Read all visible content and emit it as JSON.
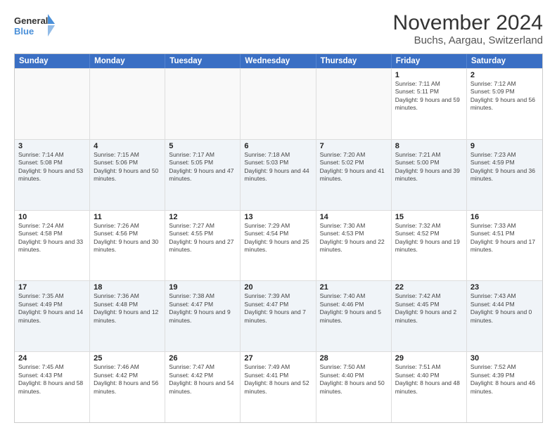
{
  "logo": {
    "line1": "General",
    "line2": "Blue"
  },
  "title": "November 2024",
  "subtitle": "Buchs, Aargau, Switzerland",
  "days": [
    "Sunday",
    "Monday",
    "Tuesday",
    "Wednesday",
    "Thursday",
    "Friday",
    "Saturday"
  ],
  "rows": [
    [
      {
        "day": "",
        "info": ""
      },
      {
        "day": "",
        "info": ""
      },
      {
        "day": "",
        "info": ""
      },
      {
        "day": "",
        "info": ""
      },
      {
        "day": "",
        "info": ""
      },
      {
        "day": "1",
        "info": "Sunrise: 7:11 AM\nSunset: 5:11 PM\nDaylight: 9 hours and 59 minutes."
      },
      {
        "day": "2",
        "info": "Sunrise: 7:12 AM\nSunset: 5:09 PM\nDaylight: 9 hours and 56 minutes."
      }
    ],
    [
      {
        "day": "3",
        "info": "Sunrise: 7:14 AM\nSunset: 5:08 PM\nDaylight: 9 hours and 53 minutes."
      },
      {
        "day": "4",
        "info": "Sunrise: 7:15 AM\nSunset: 5:06 PM\nDaylight: 9 hours and 50 minutes."
      },
      {
        "day": "5",
        "info": "Sunrise: 7:17 AM\nSunset: 5:05 PM\nDaylight: 9 hours and 47 minutes."
      },
      {
        "day": "6",
        "info": "Sunrise: 7:18 AM\nSunset: 5:03 PM\nDaylight: 9 hours and 44 minutes."
      },
      {
        "day": "7",
        "info": "Sunrise: 7:20 AM\nSunset: 5:02 PM\nDaylight: 9 hours and 41 minutes."
      },
      {
        "day": "8",
        "info": "Sunrise: 7:21 AM\nSunset: 5:00 PM\nDaylight: 9 hours and 39 minutes."
      },
      {
        "day": "9",
        "info": "Sunrise: 7:23 AM\nSunset: 4:59 PM\nDaylight: 9 hours and 36 minutes."
      }
    ],
    [
      {
        "day": "10",
        "info": "Sunrise: 7:24 AM\nSunset: 4:58 PM\nDaylight: 9 hours and 33 minutes."
      },
      {
        "day": "11",
        "info": "Sunrise: 7:26 AM\nSunset: 4:56 PM\nDaylight: 9 hours and 30 minutes."
      },
      {
        "day": "12",
        "info": "Sunrise: 7:27 AM\nSunset: 4:55 PM\nDaylight: 9 hours and 27 minutes."
      },
      {
        "day": "13",
        "info": "Sunrise: 7:29 AM\nSunset: 4:54 PM\nDaylight: 9 hours and 25 minutes."
      },
      {
        "day": "14",
        "info": "Sunrise: 7:30 AM\nSunset: 4:53 PM\nDaylight: 9 hours and 22 minutes."
      },
      {
        "day": "15",
        "info": "Sunrise: 7:32 AM\nSunset: 4:52 PM\nDaylight: 9 hours and 19 minutes."
      },
      {
        "day": "16",
        "info": "Sunrise: 7:33 AM\nSunset: 4:51 PM\nDaylight: 9 hours and 17 minutes."
      }
    ],
    [
      {
        "day": "17",
        "info": "Sunrise: 7:35 AM\nSunset: 4:49 PM\nDaylight: 9 hours and 14 minutes."
      },
      {
        "day": "18",
        "info": "Sunrise: 7:36 AM\nSunset: 4:48 PM\nDaylight: 9 hours and 12 minutes."
      },
      {
        "day": "19",
        "info": "Sunrise: 7:38 AM\nSunset: 4:47 PM\nDaylight: 9 hours and 9 minutes."
      },
      {
        "day": "20",
        "info": "Sunrise: 7:39 AM\nSunset: 4:47 PM\nDaylight: 9 hours and 7 minutes."
      },
      {
        "day": "21",
        "info": "Sunrise: 7:40 AM\nSunset: 4:46 PM\nDaylight: 9 hours and 5 minutes."
      },
      {
        "day": "22",
        "info": "Sunrise: 7:42 AM\nSunset: 4:45 PM\nDaylight: 9 hours and 2 minutes."
      },
      {
        "day": "23",
        "info": "Sunrise: 7:43 AM\nSunset: 4:44 PM\nDaylight: 9 hours and 0 minutes."
      }
    ],
    [
      {
        "day": "24",
        "info": "Sunrise: 7:45 AM\nSunset: 4:43 PM\nDaylight: 8 hours and 58 minutes."
      },
      {
        "day": "25",
        "info": "Sunrise: 7:46 AM\nSunset: 4:42 PM\nDaylight: 8 hours and 56 minutes."
      },
      {
        "day": "26",
        "info": "Sunrise: 7:47 AM\nSunset: 4:42 PM\nDaylight: 8 hours and 54 minutes."
      },
      {
        "day": "27",
        "info": "Sunrise: 7:49 AM\nSunset: 4:41 PM\nDaylight: 8 hours and 52 minutes."
      },
      {
        "day": "28",
        "info": "Sunrise: 7:50 AM\nSunset: 4:40 PM\nDaylight: 8 hours and 50 minutes."
      },
      {
        "day": "29",
        "info": "Sunrise: 7:51 AM\nSunset: 4:40 PM\nDaylight: 8 hours and 48 minutes."
      },
      {
        "day": "30",
        "info": "Sunrise: 7:52 AM\nSunset: 4:39 PM\nDaylight: 8 hours and 46 minutes."
      }
    ]
  ]
}
